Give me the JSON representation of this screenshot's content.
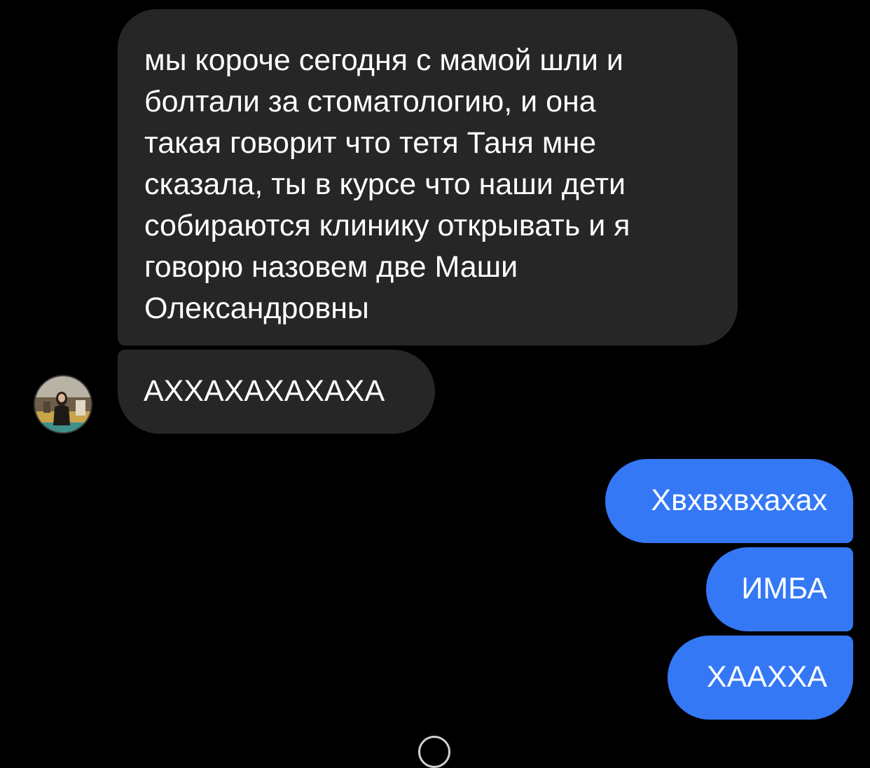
{
  "conversation": {
    "messages": [
      {
        "sender": "contact",
        "text": "мы короче сегодня с мамой шли и\nболтали за стоматологию, и она\nтакая говорит что тетя Таня мне\nсказала, ты в курсе что наши дети\nсобираются клинику открывать и я\nговорю назовем две Маши\nОлександровны"
      },
      {
        "sender": "contact",
        "text": "АХХАХАХАХАХА"
      },
      {
        "sender": "me",
        "text": "Хвхвхвхахах"
      },
      {
        "sender": "me",
        "text": "ИМБА"
      },
      {
        "sender": "me",
        "text": "ХААХХА"
      }
    ],
    "contact_avatar_icon": "profile-photo"
  },
  "colors": {
    "background": "#000000",
    "incoming_bubble": "#262626",
    "outgoing_bubble": "#3478f6",
    "text": "#ffffff"
  }
}
